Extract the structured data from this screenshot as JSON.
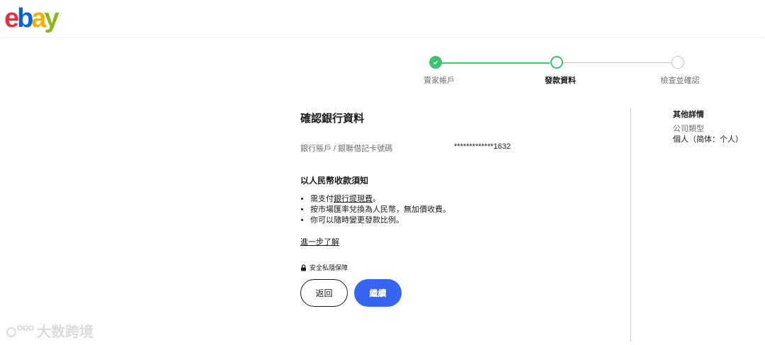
{
  "header": {
    "logo": [
      "e",
      "b",
      "a",
      "y"
    ]
  },
  "stepper": {
    "steps": [
      {
        "label": "賣家帳戶",
        "state": "complete"
      },
      {
        "label": "發款資料",
        "state": "current"
      },
      {
        "label": "檢查並確認",
        "state": "pending"
      }
    ],
    "colors": {
      "complete": "#3ac46d",
      "pending": "#c7c7c7"
    }
  },
  "main": {
    "title": "確認銀行資料",
    "bank_label": "銀行賬戶 / 銀聯借記卡號碼",
    "bank_value": "*************1632",
    "notice_title": "以人民幣收款須知",
    "bullet1_prefix": "需支付",
    "bullet1_link": "銀行提現費",
    "bullet1_suffix": "。",
    "bullet2": "按市場匯率兌換為人民幣，無加價收費。",
    "bullet3": "你可以隨時變更發款比例。",
    "learn_more": "進一步了解",
    "privacy": "安全私隱保障",
    "back_button": "返回",
    "continue_button": "繼續"
  },
  "side": {
    "title": "其他詳情",
    "company_type_label": "公司類型",
    "company_type_value": "個人（简体：个人）"
  },
  "watermark": "大数跨境"
}
